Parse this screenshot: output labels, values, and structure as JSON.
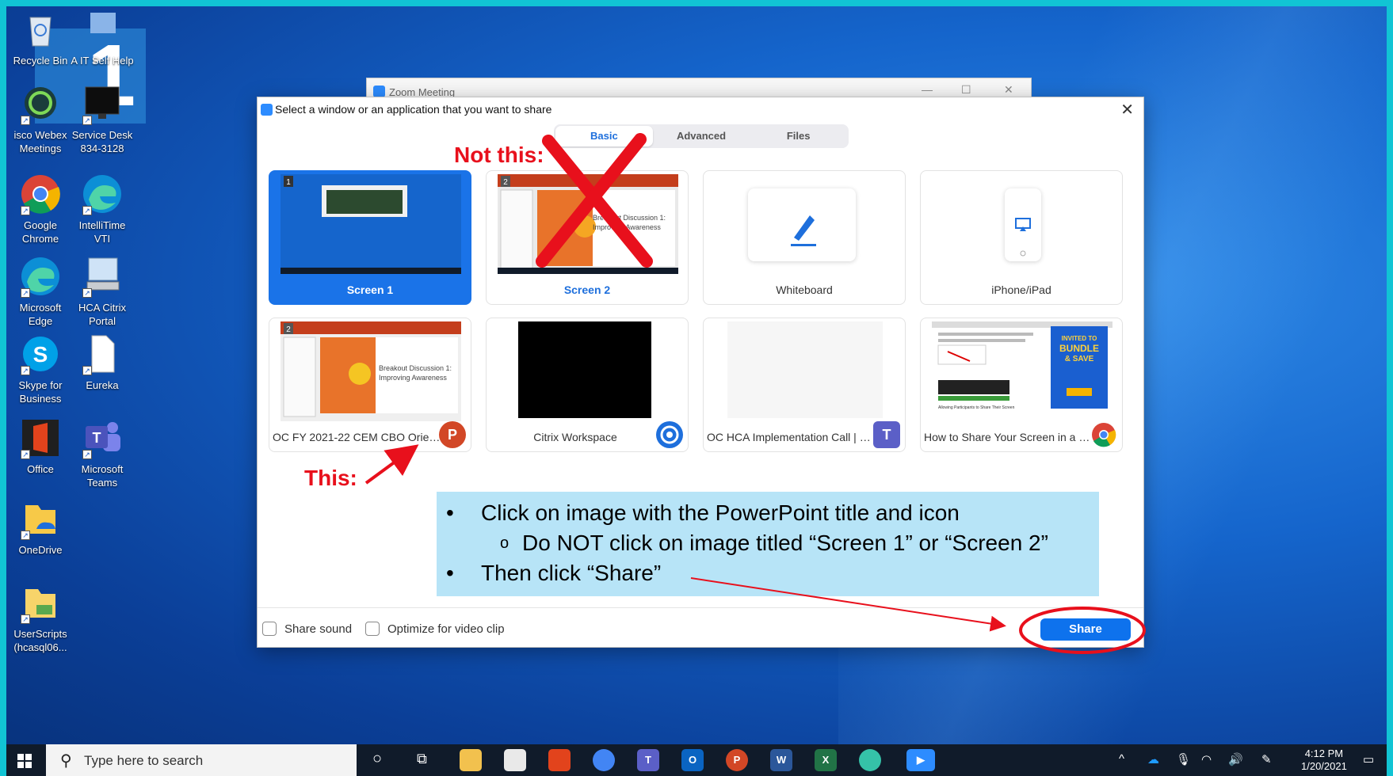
{
  "desktop": {
    "big_number": "1",
    "icons": [
      {
        "label": "Recycle Bin",
        "icon": "recycle-bin-icon"
      },
      {
        "label": "A IT Self Help",
        "icon": "it-help-icon"
      },
      {
        "label": "isco Webex Meetings",
        "icon": "webex-icon"
      },
      {
        "label": "Service Desk 834-3128",
        "icon": "monitor-icon"
      },
      {
        "label": "Google Chrome",
        "icon": "chrome-icon"
      },
      {
        "label": "IntelliTime VTI",
        "icon": "edge-icon"
      },
      {
        "label": "Microsoft Edge",
        "icon": "edge-icon"
      },
      {
        "label": "HCA Citrix Portal",
        "icon": "computer-icon"
      },
      {
        "label": "Skype for Business",
        "icon": "skype-icon"
      },
      {
        "label": "Eureka",
        "icon": "file-icon"
      },
      {
        "label": "Office",
        "icon": "office-icon"
      },
      {
        "label": "Microsoft Teams",
        "icon": "teams-icon"
      },
      {
        "label": "OneDrive",
        "icon": "folder-icon"
      },
      {
        "label": "UserScripts (hcasql06...",
        "icon": "folder-icon"
      }
    ]
  },
  "zoom_window": {
    "title": "Zoom Meeting"
  },
  "dialog": {
    "title": "Select a window or an application that you want to share",
    "tabs": [
      {
        "label": "Basic",
        "active": true
      },
      {
        "label": "Advanced",
        "active": false
      },
      {
        "label": "Files",
        "active": false
      }
    ],
    "tiles": [
      {
        "label": "Screen 1",
        "selected": true,
        "number": "1"
      },
      {
        "label": "Screen 2",
        "selected": false,
        "number": "2"
      },
      {
        "label": "Whiteboard",
        "selected": false
      },
      {
        "label": "iPhone/iPad",
        "selected": false
      },
      {
        "label": "OC FY 2021-22 CEM CBO Orienta...",
        "app_badge": "P",
        "badge_color": "#d24726",
        "number": "2"
      },
      {
        "label": "Citrix Workspace",
        "app_badge": "citrix",
        "badge_color": "#1e6fdc"
      },
      {
        "label": "OC HCA Implementation Call | Mi...",
        "app_badge": "T",
        "badge_color": "#5b5fc7"
      },
      {
        "label": "How to Share Your Screen in a Zo...",
        "app_badge": "chrome",
        "badge_color": "#4285f4"
      }
    ],
    "slide_text": {
      "line1": "Breakout Discussion 1:",
      "line2": "Improving Awareness"
    },
    "ad_text": {
      "line1": "INVITED TO",
      "line2": "BUNDLE",
      "line3": "& SAVE"
    },
    "article_caption": "Allowing Participants to Share Their Screen",
    "footer": {
      "share_sound": "Share sound",
      "optimize": "Optimize for video clip",
      "share_button": "Share"
    }
  },
  "annotations": {
    "not_this": "Not this:",
    "this": "This:",
    "instructions": [
      "Click on image with the PowerPoint title and icon",
      "Do NOT click on image titled “Screen 1” or “Screen 2”",
      "Then click “Share”"
    ],
    "colors": {
      "annotation_red": "#e8101c",
      "instruction_bg": "#b7e4f7"
    }
  },
  "taskbar": {
    "search_placeholder": "Type here to search",
    "apps": [
      "cortana-icon",
      "task-view-icon",
      "file-explorer-icon",
      "store-icon",
      "office-icon",
      "chrome-icon",
      "teams-icon",
      "outlook-icon",
      "powerpoint-icon",
      "word-icon",
      "excel-icon",
      "webex-icon",
      "zoom-icon"
    ],
    "time": "4:12 PM",
    "date": "1/20/2021"
  }
}
